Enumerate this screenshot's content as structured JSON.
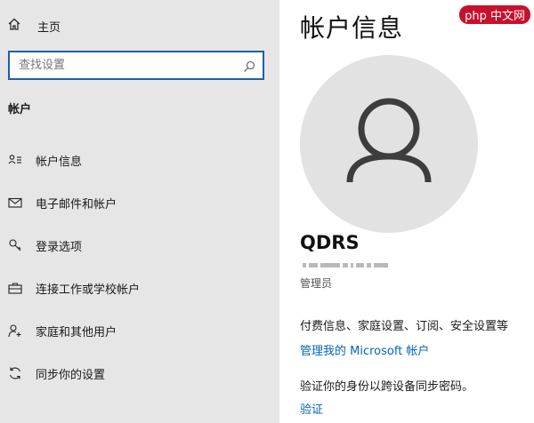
{
  "sidebar": {
    "home_label": "主页",
    "search_placeholder": "查找设置",
    "section_title": "帐户",
    "items": [
      {
        "label": "帐户信息",
        "icon": "person-list-icon"
      },
      {
        "label": "电子邮件和帐户",
        "icon": "mail-icon"
      },
      {
        "label": "登录选项",
        "icon": "key-icon"
      },
      {
        "label": "连接工作或学校帐户",
        "icon": "briefcase-icon"
      },
      {
        "label": "家庭和其他用户",
        "icon": "person-add-icon"
      },
      {
        "label": "同步你的设置",
        "icon": "sync-icon"
      }
    ]
  },
  "main": {
    "title": "帐户信息",
    "username": "QDRS",
    "role": "管理员",
    "billing_text": "付费信息、家庭设置、订阅、安全设置等",
    "manage_link": "管理我的 Microsoft 帐户",
    "verify_text": "验证你的身份以跨设备同步密码。",
    "verify_link": "验证"
  },
  "watermark": "php 中文网",
  "colors": {
    "sidebar_bg": "#e6e6e6",
    "accent": "#0067b8",
    "search_border": "#1f5fa8"
  }
}
